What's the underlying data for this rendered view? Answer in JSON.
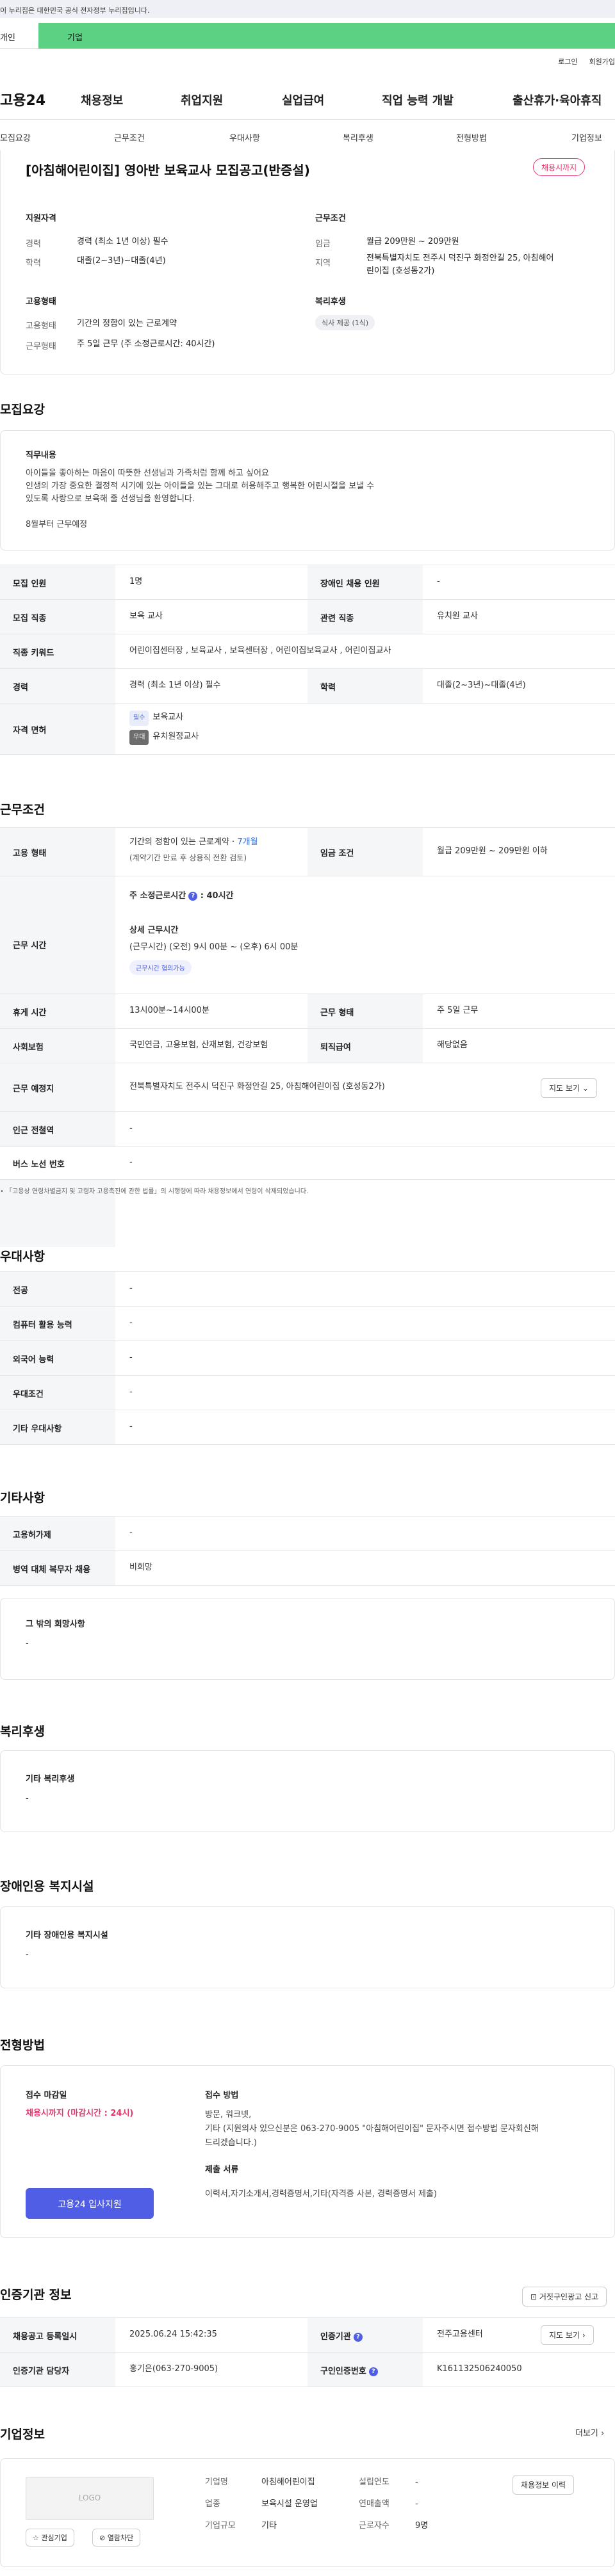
{
  "gov_banner": "이 누리집은 대한민국 공식 전자정부 누리집입니다.",
  "user_tabs": {
    "person": "개인",
    "company": "기업"
  },
  "util_links": [
    "로그인",
    "회원가입"
  ],
  "gnb": {
    "logo": "고용24",
    "items": [
      "채용정보",
      "취업지원",
      "실업급여",
      "직업 능력 개발",
      "출산휴가·육아휴직"
    ]
  },
  "subnav": [
    "모집요강",
    "근무조건",
    "우대사항",
    "복리후생",
    "전형방법",
    "기업정보"
  ],
  "header": {
    "title": "[아침해어린이집] 영아반 보육교사 모집공고(반증설)",
    "deadline_badge": "채용시까지"
  },
  "summary": {
    "qualification_label": "지원자격",
    "career_key": "경력",
    "career_val": "경력 (최소 1년 이상) 필수",
    "edu_key": "학력",
    "edu_val": "대졸(2~3년)~대졸(4년)",
    "employment_label": "고용형태",
    "emp_type_key": "고용형태",
    "emp_type_val": "기간의 정함이 있는 근로계약",
    "work_type_key": "근무형태",
    "work_type_val": "주 5일 근무 (주 소정근로시간: 40시간)",
    "conditions_label": "근무조건",
    "wage_key": "임금",
    "wage_val": "월급 209만원 ~ 209만원",
    "region_key": "지역",
    "region_val1": "전북특별자치도 전주시 덕진구 화정안길 25, 아침해어",
    "region_val2": "린이집 (호성동2가)",
    "welfare_label": "복리후생",
    "welfare_chip": "식사 제공 (1식)"
  },
  "recruit": {
    "heading": "모집요강",
    "duty_title": "직무내용",
    "duty_lines": [
      "아이들을 좋아하는 마음이 따뜻한 선생님과 가족처럼 함께 하고 싶어요",
      "인생의 가장 중요한 결정적 시기에 있는 아이들을 있는 그대로 허용해주고 행복한 어린시절을 보낼 수",
      "있도록 사랑으로 보육해 줄 선생님을 환영합니다.",
      "",
      "8월부터 근무예정"
    ],
    "rows": {
      "count_k": "모집 인원",
      "count_v": "1명",
      "disabled_k": "장애인 채용 인원",
      "disabled_v": "-",
      "job_k": "모집 직종",
      "job_v": "보육 교사",
      "rel_k": "관련 직종",
      "rel_v": "유치원 교사",
      "kw_k": "직종 키워드",
      "kw_v": "어린이집센터장 , 보육교사 , 보육센터장 , 어린이집보육교사 , 어린이집교사",
      "career_k": "경력",
      "career_v": "경력 (최소 1년 이상) 필수",
      "edu_k": "학력",
      "edu_v": "대졸(2~3년)~대졸(4년)",
      "license_k": "자격 면허",
      "license_req_tag": "필수",
      "license_req": "보육교사",
      "license_opt_tag": "우대",
      "license_opt": "유치원정교사"
    }
  },
  "conditions": {
    "heading": "근무조건",
    "emp_k": "고용 형태",
    "emp_v1": "기간의 정함이 있는 근로계약 · ",
    "emp_v1b": "7개월",
    "emp_v2": "(계약기간 만료 후 상용직 전환 검토)",
    "wage_k": "임금 조건",
    "wage_v": "월급 209만원 ~ 209만원 이하",
    "hours_k": "근무 시간",
    "hours_week": "주 소정근로시간",
    "hours_week_v": ": 40시간",
    "hours_detail_t": "상세 근무시간",
    "hours_detail_v": "(근무시간) (오전) 9시 00분 ~ (오후) 6시 00분",
    "hours_neg": "근무시간 협의가능",
    "rest_k": "휴게 시간",
    "rest_v": "13시00분~14시00분",
    "form_k": "근무 형태",
    "form_v": "주 5일 근무",
    "ins_k": "사회보험",
    "ins_v": "국민연금, 고용보험, 산재보험, 건강보험",
    "sev_k": "퇴직급여",
    "sev_v": "해당없음",
    "place_k": "근무 예정지",
    "place_v": "전북특별자치도 전주시 덕진구 화정안길 25, 아침해어린이집 (호성동2가)",
    "map_btn": "지도 보기",
    "subway_k": "인근 전철역",
    "subway_v": "-",
    "bus_k": "버스 노선 번호",
    "bus_v": "-",
    "note": "「고용상 연령차별금지 및 고령자 고용촉진에 관한 법률」의 시행령에 따라 채용정보에서 연령이 삭제되었습니다."
  },
  "preference": {
    "heading": "우대사항",
    "major_k": "전공",
    "major_v": "-",
    "comp_k": "컴퓨터 활용 능력",
    "comp_v": "-",
    "lang_k": "외국어 능력",
    "lang_v": "-",
    "cond_k": "우대조건",
    "cond_v": "-",
    "etc_k": "기타 우대사항",
    "etc_v": "-"
  },
  "other": {
    "heading": "기타사항",
    "ins_k": "고용허가제",
    "ins_v": "-",
    "mil_k": "병역 대체 복무자 채용",
    "mil_v": "비희망",
    "extra_title": "그 밖의 희망사항",
    "extra_v": "-"
  },
  "welfare": {
    "heading": "복리후생",
    "title": "기타 복리후생",
    "value": "-"
  },
  "disabled_fac": {
    "heading": "장애인용 복지시설",
    "title": "기타 장애인용 복지시설",
    "value": "-"
  },
  "process": {
    "heading": "전형방법",
    "deadline_t": "접수 마감일",
    "deadline_v": "채용시까지 (마감시간 : 24시)",
    "method_t": "접수 방법",
    "method_v1": "방문, 워크넷,",
    "method_v2": "기타 (지원의사 있으신분은 063-270-9005 \"아침해어린이집\" 문자주시면 접수방법 문자회신해",
    "method_v3": "드리겠습니다.)",
    "docs_t": "제출 서류",
    "docs_v": "이력서,자기소개서,경력증명서,기타(자격증 사본, 경력증명서 제출)",
    "apply_btn": "고용24 입사지원"
  },
  "agency": {
    "heading": "인증기관 정보",
    "report_btn": "거짓구인광고 신고",
    "date_k": "채용공고 등록일시",
    "date_v": "2025.06.24 15:42:35",
    "org_k": "인증기관",
    "org_v": "전주고용센터",
    "map_btn": "지도 보기",
    "mgr_k": "인증기관 담당자",
    "mgr_v": "홍기은(063-270-9005)",
    "num_k": "구인인증번호",
    "num_v": "K161132506240050"
  },
  "company": {
    "heading": "기업정보",
    "more": "더보기",
    "logo_text": "LOGO",
    "interest_btn": "관심기업",
    "block_btn": "열람차단",
    "name_k": "기업명",
    "name_v": "아침해어린이집",
    "year_k": "설립연도",
    "year_v": "-",
    "industry_k": "업종",
    "industry_v": "보육시설 운영업",
    "sales_k": "연매출액",
    "sales_v": "-",
    "size_k": "기업규모",
    "size_v": "기타",
    "emp_k": "근로자수",
    "emp_v": "9명",
    "jobs_btn": "채용정보 이력"
  }
}
